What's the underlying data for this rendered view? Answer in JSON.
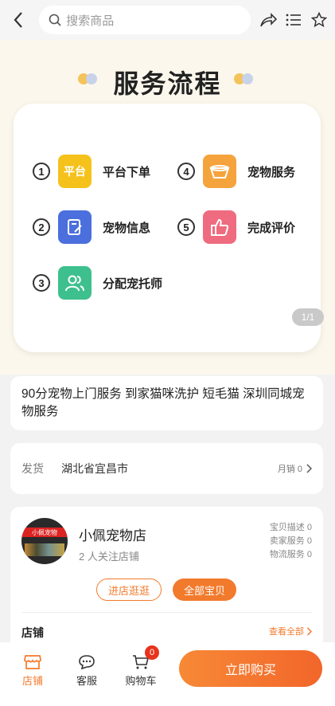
{
  "search": {
    "placeholder": "搜索商品"
  },
  "banner": {
    "title": "服务流程",
    "steps": [
      {
        "num": "1",
        "icon_text": "平台",
        "label": "平台下单"
      },
      {
        "num": "2",
        "icon_text": "",
        "label": "宠物信息"
      },
      {
        "num": "3",
        "icon_text": "",
        "label": "分配宠托师"
      },
      {
        "num": "4",
        "icon_text": "",
        "label": "宠物服务"
      },
      {
        "num": "5",
        "icon_text": "",
        "label": "完成评价"
      }
    ],
    "pager": "1/1"
  },
  "product": {
    "title": "90分宠物上门服务 到家猫咪洗护 短毛猫 深圳同城宠物服务",
    "ship_label": "发货",
    "ship_location": "湖北省宜昌市",
    "monthly_sales": "月销 0"
  },
  "shop": {
    "avatar_text": "小佩宠物",
    "name": "小佩宠物店",
    "followers": "2 人关注店铺",
    "ratings": [
      "宝贝描述 0",
      "卖家服务 0",
      "物流服务 0"
    ],
    "enter_button": "进店逛逛",
    "all_items_button": "全部宝贝",
    "section_label": "店铺",
    "see_all": "查看全部"
  },
  "bottom_bar": {
    "tabs": [
      {
        "label": "店铺",
        "icon": "store-icon"
      },
      {
        "label": "客服",
        "icon": "chat-icon"
      },
      {
        "label": "购物车",
        "icon": "cart-icon",
        "badge": "0"
      }
    ],
    "buy_now": "立即购买"
  },
  "colors": {
    "accent": "#f27a2c",
    "badge": "#e8321d"
  }
}
